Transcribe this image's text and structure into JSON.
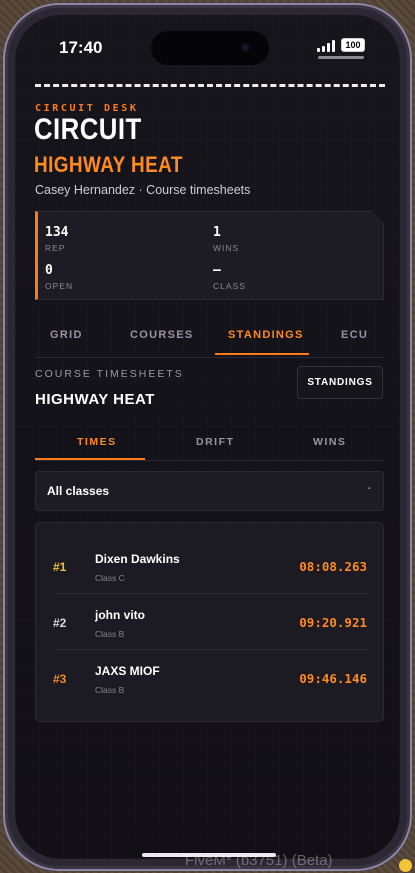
{
  "status_bar": {
    "time": "17:40",
    "battery": "100"
  },
  "header": {
    "kicker": "CIRCUIT DESK",
    "title": "CIRCUIT",
    "subtitle_title": "HIGHWAY HEAT",
    "subtitle": "Casey Hernandez · Course timesheets"
  },
  "stats": [
    {
      "value": "134",
      "label": "REP"
    },
    {
      "value": "1",
      "label": "WINS"
    },
    {
      "value": "0",
      "label": "OPEN"
    },
    {
      "value": "—",
      "label": "CLASS"
    }
  ],
  "tabs": [
    {
      "label": "GRID",
      "active": false
    },
    {
      "label": "COURSES",
      "active": false
    },
    {
      "label": "STANDINGS",
      "active": true
    },
    {
      "label": "ECU",
      "active": false
    }
  ],
  "section": {
    "label": "COURSE TIMESHEETS",
    "title": "HIGHWAY HEAT",
    "button_label": "STANDINGS"
  },
  "subtabs": [
    {
      "label": "TIMES",
      "active": true
    },
    {
      "label": "DRIFT",
      "active": false
    },
    {
      "label": "WINS",
      "active": false
    }
  ],
  "filter": {
    "selected": "All classes",
    "chevron": "-"
  },
  "leaderboard": [
    {
      "rank": "#1",
      "name": "Dixen Dawkins",
      "class": "Class C",
      "time": "08:08.263",
      "rank_color": "#f2c32c"
    },
    {
      "rank": "#2",
      "name": "john vito",
      "class": "Class B",
      "time": "09:20.921",
      "rank_color": "#d9d6df"
    },
    {
      "rank": "#3",
      "name": "JAXS MIOF",
      "class": "Class B",
      "time": "09:46.146",
      "rank_color": "#f08a2a"
    }
  ],
  "watermark": "FiveM* (b3751) (Beta)",
  "colors": {
    "accent": "#ff7a1a",
    "background": "#15131a",
    "panel": "#1d1b23"
  }
}
